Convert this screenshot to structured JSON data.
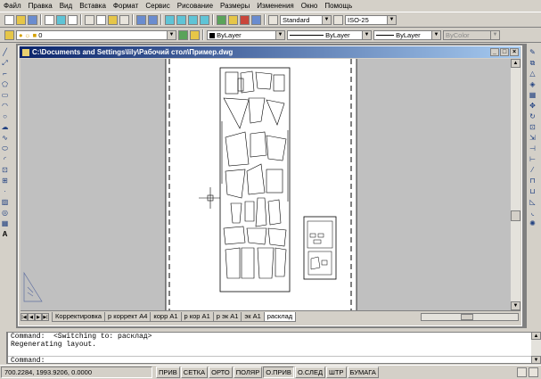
{
  "menu": [
    "Файл",
    "Правка",
    "Вид",
    "Вставка",
    "Формат",
    "Сервис",
    "Рисование",
    "Размеры",
    "Изменения",
    "Окно",
    "Помощь"
  ],
  "toolbar": {
    "text_style": "Standard",
    "dim_style": "ISO-25",
    "layer": "0",
    "color": "ByLayer",
    "linetype": "ByLayer",
    "lineweight": "ByLayer",
    "plotstyle": "ByColor"
  },
  "window": {
    "title": "C:\\Documents and Settings\\lily\\Рабочий стол\\Пример.dwg",
    "min": "_",
    "max": "□",
    "close": "×"
  },
  "tabs": [
    "Корректировка",
    "р коррект А4",
    "корр А1",
    "р кор А1",
    "р эк А1",
    "эк А1",
    "расклад"
  ],
  "active_tab": "расклад",
  "command_lines": [
    "Command:  <Switching to: расклад>",
    "Regenerating layout.",
    "",
    "Command:"
  ],
  "status": {
    "coords": "700.2284, 1993.9206, 0.0000",
    "buttons": [
      "ПРИВ",
      "СЕТКА",
      "ОРТО",
      "ПОЛЯР",
      "О.ПРИВ",
      "О.СЛЕД",
      "ШТР",
      "БУМАГА"
    ]
  }
}
